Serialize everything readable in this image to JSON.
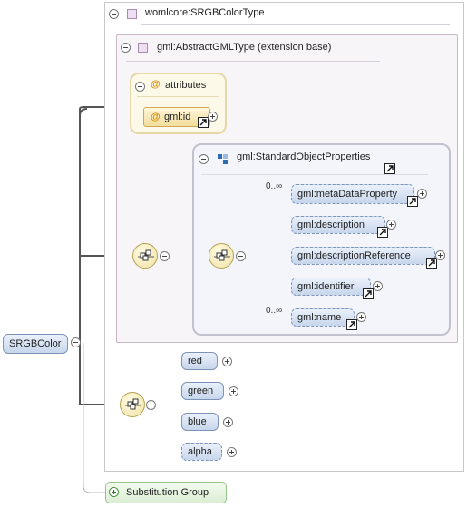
{
  "root": {
    "label": "SRGBColor"
  },
  "type": {
    "label": "womlcore:SRGBColorType"
  },
  "extension": {
    "label": "gml:AbstractGMLType (extension base)"
  },
  "attributes": {
    "label": "attributes",
    "attribute": "gml:id"
  },
  "group": {
    "label": "gml:StandardObjectProperties"
  },
  "gml_elements": [
    {
      "label": "gml:metaDataProperty",
      "cardinality": "0..∞"
    },
    {
      "label": "gml:description"
    },
    {
      "label": "gml:descriptionReference"
    },
    {
      "label": "gml:identifier"
    },
    {
      "label": "gml:name",
      "cardinality": "0..∞"
    }
  ],
  "color_elements": [
    {
      "label": "red"
    },
    {
      "label": "green"
    },
    {
      "label": "blue"
    },
    {
      "label": "alpha"
    }
  ],
  "substitution": {
    "label": "Substitution Group"
  },
  "colors": {
    "pill_border": "#7d94b8",
    "attr_border": "#d0a85a",
    "line": "#555555"
  }
}
